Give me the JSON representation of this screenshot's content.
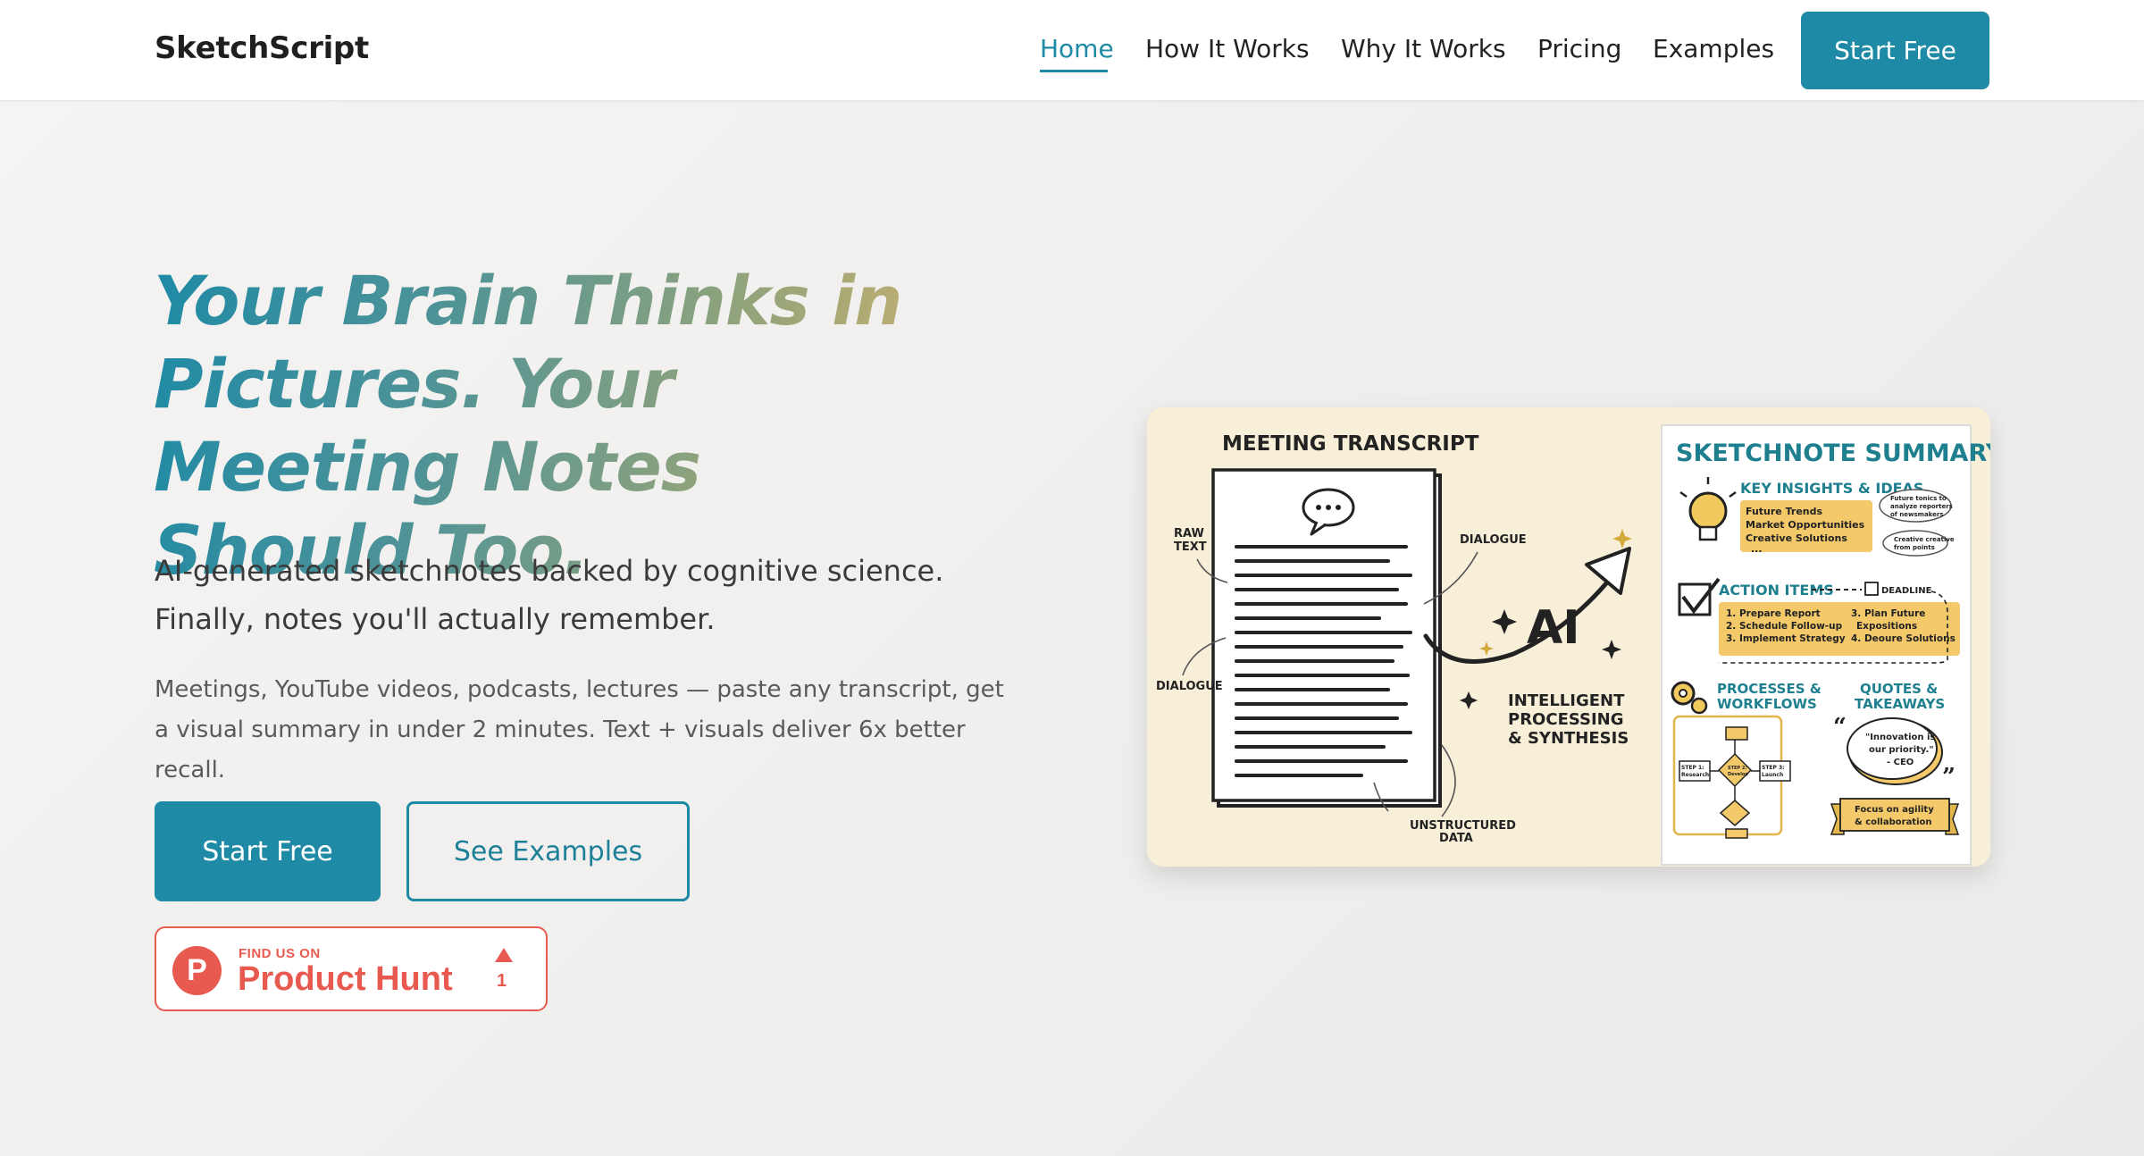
{
  "nav": {
    "brand": "SketchScript",
    "links": [
      {
        "label": "Home",
        "active": true
      },
      {
        "label": "How It Works"
      },
      {
        "label": "Why It Works"
      },
      {
        "label": "Pricing"
      },
      {
        "label": "Examples"
      }
    ],
    "cta": "Start Free"
  },
  "hero": {
    "title": "Your Brain Thinks in Pictures. Your Meeting Notes Should Too.",
    "subtitle": "AI-generated sketchnotes backed by cognitive science. Finally, notes you'll actually remember.",
    "description": "Meetings, YouTube videos, podcasts, lectures — paste any transcript, get a visual summary in under 2 minutes. Text + visuals deliver 6x better recall.",
    "primary_button": "Start Free",
    "secondary_button": "See Examples"
  },
  "product_hunt": {
    "logo_letter": "P",
    "find_us": "FIND US ON",
    "name": "Product Hunt",
    "upvotes": "1"
  },
  "illustration": {
    "left_title": "MEETING TRANSCRIPT",
    "raw_text_1": "RAW",
    "raw_text_2": "TEXT",
    "dialogue_top": "DIALOGUE",
    "dialogue_left": "DIALOGUE",
    "unstructured_1": "UNSTRUCTURED",
    "unstructured_2": "DATA",
    "ai_label": "AI",
    "processing_1": "INTELLIGENT",
    "processing_2": "PROCESSING",
    "processing_3": "& SYNTHESIS",
    "right_title": "SKETCHNOTE SUMMARY",
    "insights_title": "KEY INSIGHTS & IDEAS",
    "insights": [
      "Future Trends",
      "Market Opportunities",
      "Creative Solutions"
    ],
    "insights_more": "...",
    "insight_note_1": [
      "Future tonics to",
      "analyze reporters",
      "of newsmakers"
    ],
    "insight_note_2": [
      "Creative creative",
      "from points"
    ],
    "action_title": "ACTION ITEMS",
    "deadline": "DEADLINE",
    "actions_left": [
      "1. Prepare Report",
      "2. Schedule Follow-up",
      "3. Implement Strategy"
    ],
    "actions_right": [
      "3. Plan Future",
      "Expositions",
      "4. Deoure Solutions"
    ],
    "processes_title_1": "PROCESSES &",
    "processes_title_2": "WORKFLOWS",
    "quotes_title_1": "QUOTES &",
    "quotes_title_2": "TAKEAWAYS",
    "quote_lines": [
      "\"Innovation is",
      "our priority.\"",
      "- CEO"
    ],
    "banner_1": "Focus on agility",
    "banner_2": "& collaboration",
    "step_1a": "STEP 1:",
    "step_1b": "Research",
    "step_2a": "STEP 2:",
    "step_2b": "Develop",
    "step_3a": "STEP 3:",
    "step_3b": "Launch"
  }
}
